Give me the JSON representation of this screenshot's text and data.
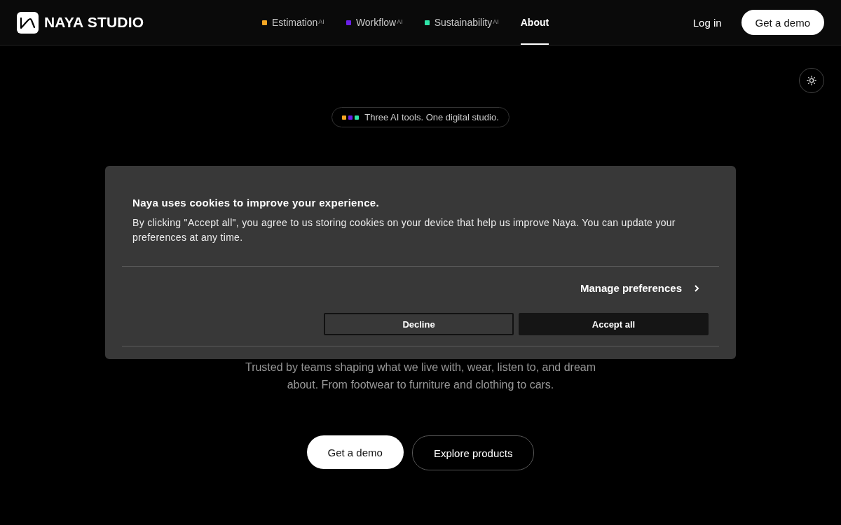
{
  "header": {
    "logo": "NAYA STUDIO",
    "nav": [
      {
        "label": "Estimation",
        "sup": "AI",
        "color": "#f5a623",
        "selected": false
      },
      {
        "label": "Workflow",
        "sup": "AI",
        "color": "#6a1fe8",
        "selected": false
      },
      {
        "label": "Sustainability",
        "sup": "AI",
        "color": "#2ee5a8",
        "selected": false
      },
      {
        "label": "About",
        "selected": true
      }
    ],
    "login": "Log in",
    "demo": "Get a demo"
  },
  "hero": {
    "badge": {
      "squares": [
        {
          "color": "#f5a623"
        },
        {
          "color": "#6a1fe8"
        },
        {
          "color": "#2ee5a8"
        }
      ],
      "text": "Three AI tools. One digital studio."
    },
    "subtitle": "Trusted by teams shaping what we live with, wear, listen to, and dream about. From footwear to furniture and clothing to cars.",
    "buttons": [
      {
        "label": "Get a demo",
        "kind": "primary"
      },
      {
        "label": "Explore products",
        "kind": "outline"
      }
    ]
  },
  "cookie_dialog": {
    "title": "Naya uses cookies to improve your experience.",
    "text": "By clicking \"Accept all\", you agree to us storing cookies on your device that help us improve Naya. You can update your preferences at any time.",
    "manage": "Manage preferences",
    "decline": "Decline",
    "accept": "Accept all"
  }
}
